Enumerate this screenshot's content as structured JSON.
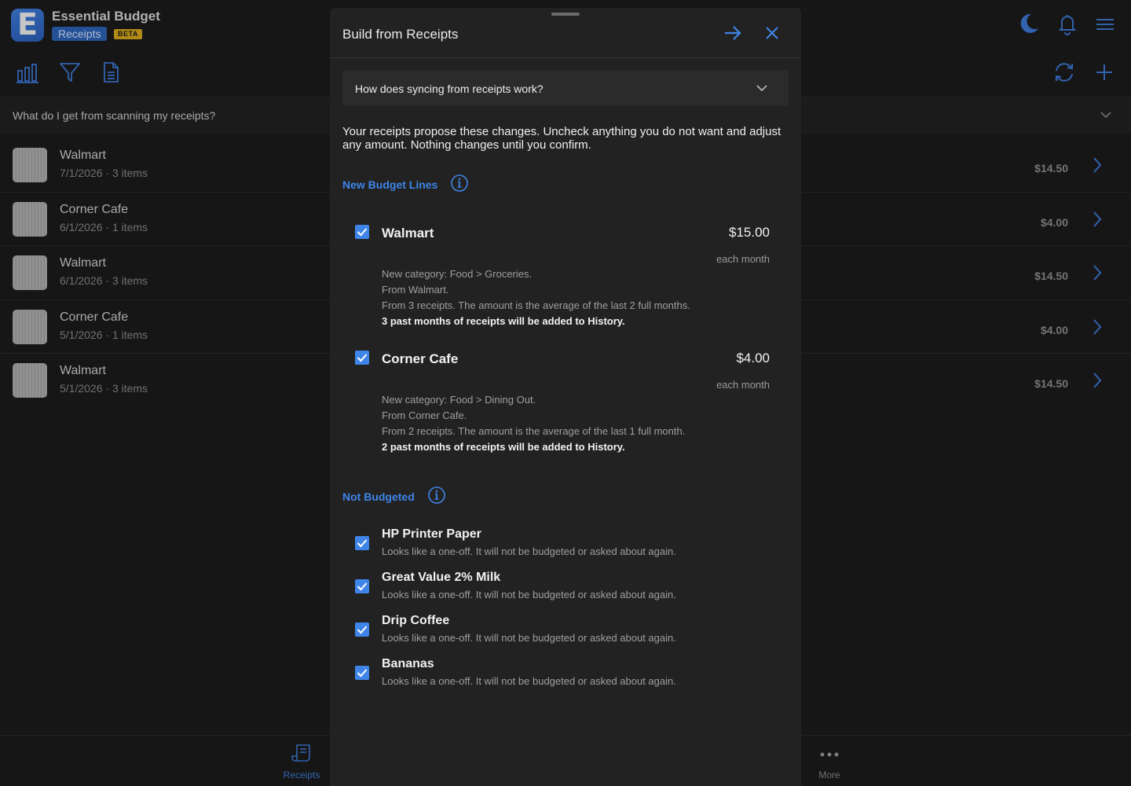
{
  "app": {
    "logo_letter": "E",
    "title": "Essential Budget",
    "section": "Receipts",
    "beta": "BETA"
  },
  "icons": {
    "top_right": [
      "moon-icon",
      "bell-icon",
      "menu-icon"
    ],
    "toolbar_left": [
      "bar-chart-icon",
      "filter-icon",
      "document-icon"
    ],
    "toolbar_right": [
      "sync-icon",
      "plus-icon"
    ]
  },
  "faq": {
    "question": "What do I get from scanning my receipts?"
  },
  "receipts": [
    {
      "merchant": "Walmart",
      "meta": "7/1/2026 · 3 items",
      "amount": "$14.50"
    },
    {
      "merchant": "Corner Cafe",
      "meta": "6/1/2026 · 1 items",
      "amount": "$4.00"
    },
    {
      "merchant": "Walmart",
      "meta": "6/1/2026 · 3 items",
      "amount": "$14.50"
    },
    {
      "merchant": "Corner Cafe",
      "meta": "5/1/2026 · 1 items",
      "amount": "$4.00"
    },
    {
      "merchant": "Walmart",
      "meta": "5/1/2026 · 3 items",
      "amount": "$14.50"
    }
  ],
  "bottom_nav": {
    "receipts_label": "Receipts",
    "more_label": "More"
  },
  "modal": {
    "title": "Build from Receipts",
    "howto": "How does syncing from receipts work?",
    "intro": "Your receipts propose these changes. Uncheck anything you do not want and adjust any amount. Nothing changes until you confirm.",
    "new_lines_heading": "New Budget Lines",
    "new_lines": [
      {
        "checked": true,
        "name": "Walmart",
        "amount": "$15.00",
        "frequency": "each month",
        "category": "New category: Food > Groceries.",
        "from": "From Walmart.",
        "basis": "From 3 receipts. The amount is the average of the last 2 full months.",
        "history": "3 past months of receipts will be added to History."
      },
      {
        "checked": true,
        "name": "Corner Cafe",
        "amount": "$4.00",
        "frequency": "each month",
        "category": "New category: Food > Dining Out.",
        "from": "From Corner Cafe.",
        "basis": "From 2 receipts. The amount is the average of the last 1 full month.",
        "history": "2 past months of receipts will be added to History."
      }
    ],
    "not_budgeted_heading": "Not Budgeted",
    "not_budgeted": [
      {
        "checked": true,
        "name": "HP Printer Paper",
        "note": "Looks like a one-off. It will not be budgeted or asked about again."
      },
      {
        "checked": true,
        "name": "Great Value 2% Milk",
        "note": "Looks like a one-off. It will not be budgeted or asked about again."
      },
      {
        "checked": true,
        "name": "Drip Coffee",
        "note": "Looks like a one-off. It will not be budgeted or asked about again."
      },
      {
        "checked": true,
        "name": "Bananas",
        "note": "Looks like a one-off. It will not be budgeted or asked about again."
      }
    ]
  },
  "colors": {
    "accent": "#3f85e8",
    "background": "#1b1b1b",
    "modal": "#222222",
    "beta": "#d8a91b"
  }
}
